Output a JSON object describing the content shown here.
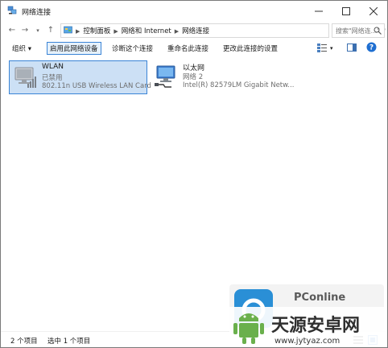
{
  "window": {
    "title": "网络连接"
  },
  "address": {
    "breadcrumbs": [
      "控制面板",
      "网络和 Internet",
      "网络连接"
    ],
    "search_placeholder": "搜索\"网络连...\""
  },
  "toolbar": {
    "organize": "组织 ▾",
    "enable": "启用此网络设备",
    "diagnose": "诊断这个连接",
    "rename": "重命名此连接",
    "change_settings": "更改此连接的设置"
  },
  "connections": [
    {
      "name": "WLAN",
      "status": "已禁用",
      "device": "802.11n USB Wireless LAN Card",
      "selected": true
    },
    {
      "name": "以太网",
      "status": "网络 2",
      "device": "Intel(R) 82579LM Gigabit Netw...",
      "selected": false
    }
  ],
  "statusbar": {
    "count": "2 个项目",
    "selected": "选中 1 个项目"
  },
  "watermarks": {
    "pconline": "PConline",
    "site_cn": "天源安卓网",
    "site_url": "www.jytyaz.com"
  }
}
